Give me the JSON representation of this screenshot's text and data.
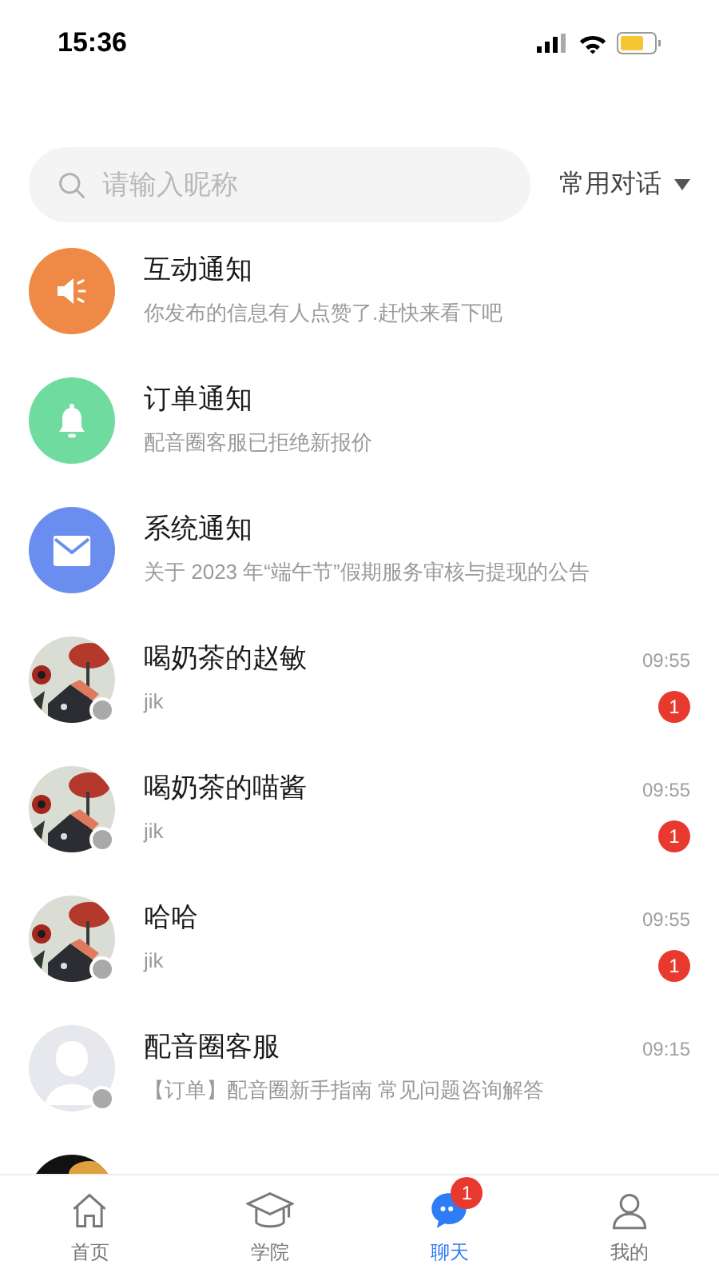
{
  "status_bar": {
    "time": "15:36"
  },
  "search": {
    "placeholder": "请输入昵称"
  },
  "filter": {
    "label": "常用对话"
  },
  "conversations": [
    {
      "kind": "notice",
      "color": "#ee8a45",
      "title": "互动通知",
      "subtitle": "你发布的信息有人点赞了.赶快来看下吧"
    },
    {
      "kind": "notice",
      "color": "#6fdb9e",
      "title": "订单通知",
      "subtitle": "配音圈客服已拒绝新报价"
    },
    {
      "kind": "notice",
      "color": "#6a8ef0",
      "title": "系统通知",
      "subtitle": "关于 2023 年“端午节”假期服务审核与提现的公告"
    },
    {
      "kind": "chat",
      "online": false,
      "title": "喝奶茶的赵敏",
      "subtitle": "jik",
      "time": "09:55",
      "unread": "1"
    },
    {
      "kind": "chat",
      "online": false,
      "title": "喝奶茶的喵酱",
      "subtitle": "jik",
      "time": "09:55",
      "unread": "1"
    },
    {
      "kind": "chat",
      "online": false,
      "title": "哈哈",
      "subtitle": "jik",
      "time": "09:55",
      "unread": "1"
    },
    {
      "kind": "chat",
      "online": false,
      "title": "配音圈客服",
      "subtitle": "【订单】配音圈新手指南 常见问题咨询解答",
      "time": "09:15"
    },
    {
      "kind": "chat"
    }
  ],
  "tabs": [
    {
      "label": "首页",
      "selected": false
    },
    {
      "label": "学院",
      "selected": false
    },
    {
      "label": "聊天",
      "selected": true,
      "badge": "1"
    },
    {
      "label": "我的",
      "selected": false
    }
  ]
}
